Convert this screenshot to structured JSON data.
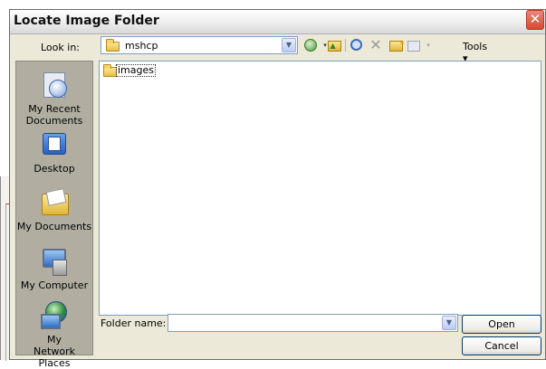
{
  "dialog": {
    "title": "Locate Image Folder",
    "close_glyph": "✕"
  },
  "lookin": {
    "label": "Look in:",
    "value": "mshcp"
  },
  "toolbar": {
    "tools_label": "Tools",
    "delete_glyph": "✕",
    "drop_glyph": "▾"
  },
  "places": [
    {
      "label": "My Recent Documents",
      "icon": "recent-documents-icon"
    },
    {
      "label": "Desktop",
      "icon": "desktop-icon"
    },
    {
      "label": "My Documents",
      "icon": "my-documents-icon"
    },
    {
      "label": "My Computer",
      "icon": "my-computer-icon"
    },
    {
      "label": "My Network Places",
      "icon": "network-places-icon"
    }
  ],
  "files": [
    {
      "name": "images",
      "icon": "folder-icon"
    }
  ],
  "filename": {
    "label": "Folder name:",
    "value": ""
  },
  "buttons": {
    "open": "Open",
    "cancel": "Cancel"
  }
}
